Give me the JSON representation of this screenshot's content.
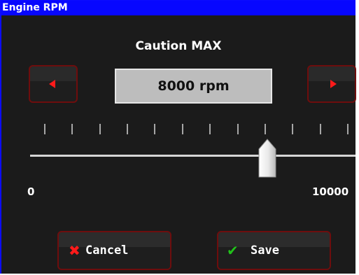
{
  "window": {
    "title": "Engine RPM"
  },
  "setting": {
    "heading": "Caution MAX",
    "value_display": "8000 rpm",
    "value": 8000,
    "unit": "rpm"
  },
  "slider": {
    "min_label": "0",
    "max_label": "10000",
    "min": 0,
    "max": 10000,
    "value": 8000,
    "tick_count": 12
  },
  "buttons": {
    "decrease_icon": "left-triangle-icon",
    "increase_icon": "right-triangle-icon",
    "cancel_label": "Cancel",
    "cancel_icon": "x-icon",
    "save_label": "Save",
    "save_icon": "checkmark-icon"
  },
  "colors": {
    "title_bar": "#0707ff",
    "background": "#1b1b1b",
    "button_border": "#6e0d0d",
    "arrow": "#ff1a1a",
    "cancel_icon": "#ff1a1a",
    "save_icon": "#21c21a",
    "value_box": "#bdbdbd"
  }
}
